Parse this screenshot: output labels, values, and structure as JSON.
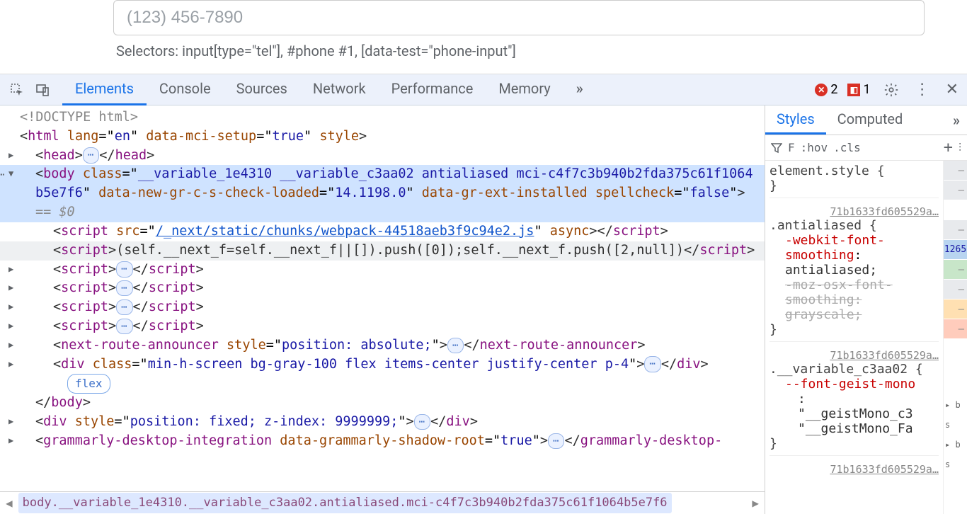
{
  "page": {
    "phone_placeholder": "(123) 456-7890",
    "selectors_text": "Selectors: input[type=\"tel\"], #phone #1, [data-test=\"phone-input\"]"
  },
  "devtools": {
    "tabs": [
      "Elements",
      "Console",
      "Sources",
      "Network",
      "Performance",
      "Memory"
    ],
    "active_tab": "Elements",
    "more_tabs_glyph": "»",
    "errors_count": "2",
    "issues_count": "1"
  },
  "dom": {
    "doctype": "<!DOCTYPE html>",
    "html_open": {
      "tag": "html",
      "attrs": [
        [
          "lang",
          "en"
        ],
        [
          "data-mci-setup",
          "true"
        ],
        [
          "style",
          ""
        ]
      ]
    },
    "head_tag": "head",
    "body_open": {
      "tag": "body",
      "class": "__variable_1e4310 __variable_c3aa02 antialiased mci-c4f7c3b940b2fda375c61f1064b5e7f6",
      "attrs": [
        [
          "data-new-gr-c-s-check-loaded",
          "14.1198.0"
        ],
        [
          "data-gr-ext-installed",
          ""
        ],
        [
          "spellcheck",
          "false"
        ]
      ],
      "eq0": "== $0"
    },
    "script_src": {
      "src": "/_next/static/chunks/webpack-44518aeb3f9c94e2.js",
      "async": "async"
    },
    "script_inline": "(self.__next_f=self.__next_f||[]).push([0]);self.__next_f.push([2,null])",
    "collapsed_scripts_count": 4,
    "next_route": {
      "tag": "next-route-announcer",
      "style": "position: absolute;"
    },
    "div_app": {
      "class": "min-h-screen bg-gray-100 flex items-center justify-center p-4"
    },
    "flex_badge": "flex",
    "body_close": "</body>",
    "div_fixed": {
      "style": "position: fixed; z-index: 9999999;"
    },
    "grammarly": {
      "tag": "grammarly-desktop-integration",
      "attr": [
        "data-grammarly-shadow-root",
        "true"
      ]
    }
  },
  "breadcrumb": {
    "active": "body.__variable_1e4310.__variable_c3aa02.antialiased.mci-c4f7c3b940b2fda375c61f1064b5e7f6"
  },
  "styles": {
    "tabs": [
      "Styles",
      "Computed"
    ],
    "active": "Styles",
    "toolbar": {
      "filter_glyph": "⫧",
      "filter_label": "F",
      "hov": ":hov",
      "cls": ".cls",
      "plus": "+"
    },
    "element_style": "element.style {",
    "rule1": {
      "src": "71b1633fd605529a…",
      "selector": ".antialiased {",
      "props": [
        {
          "n": "-webkit-font-smoothing",
          "v": "antialiased;",
          "strike": false
        },
        {
          "n": "-moz-osx-font-smoothing",
          "v": "grayscale;",
          "strike": true
        }
      ]
    },
    "rule2": {
      "src": "71b1633fd605529a…",
      "selector": ".__variable_c3aa02 {",
      "props": [
        {
          "n": "--font-geist-mono",
          "v": ":",
          "cont": [
            "\"__geistMono_c3",
            "\"__geistMono_Fa"
          ]
        }
      ]
    },
    "swatch_num": "1265",
    "footer_src": "71b1633fd605529a…"
  }
}
